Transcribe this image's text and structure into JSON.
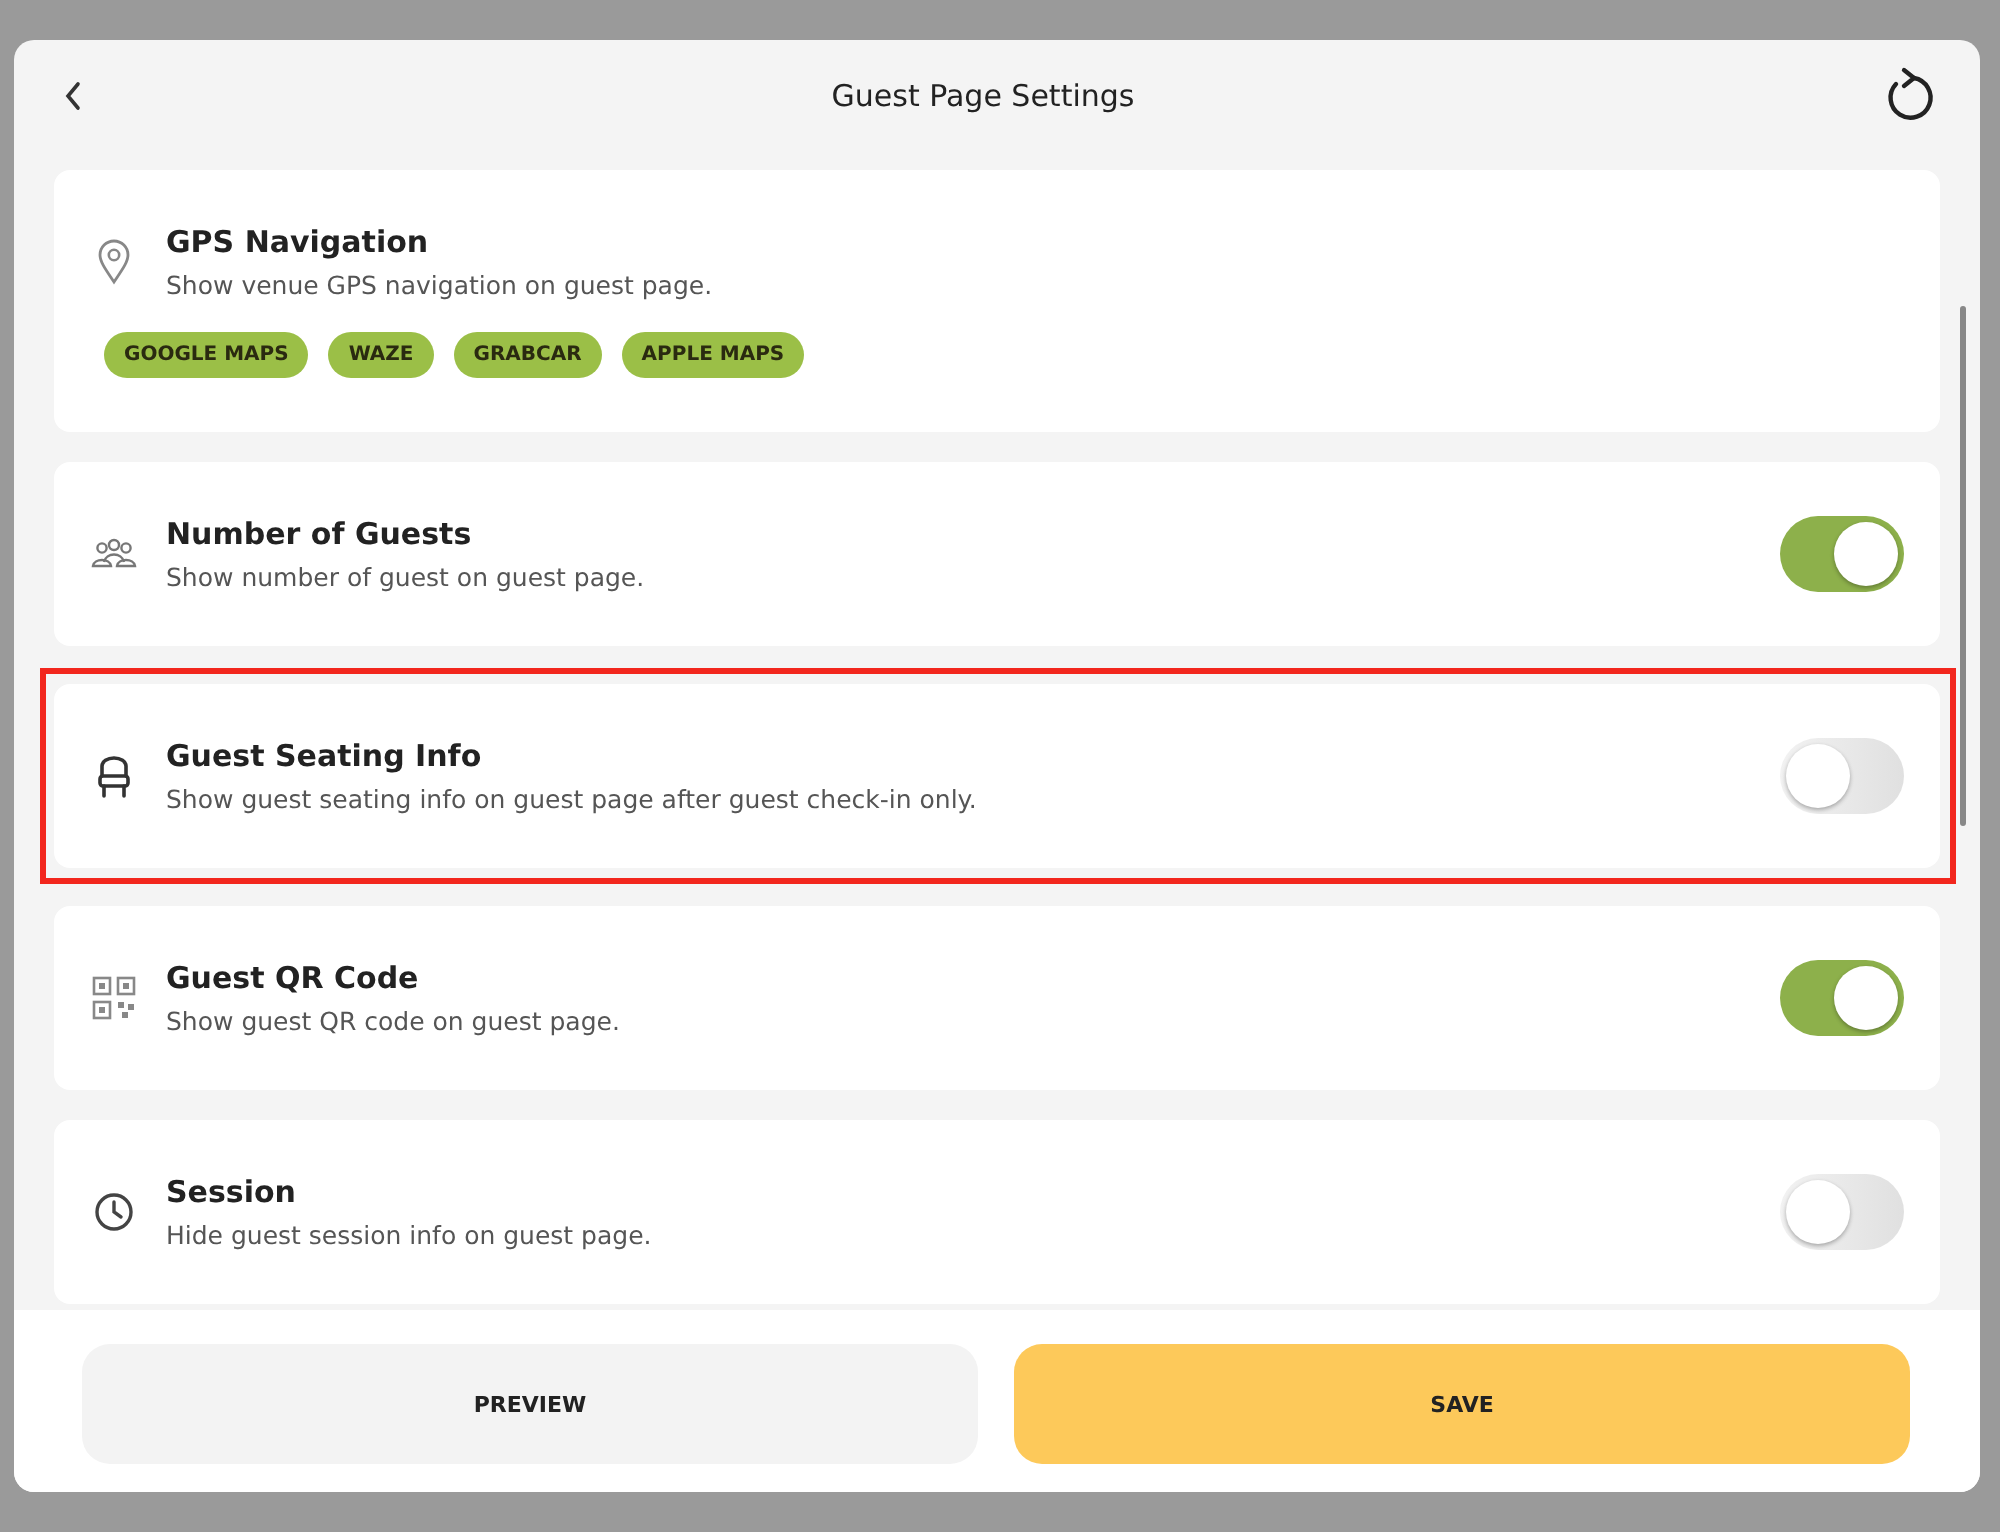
{
  "dialog": {
    "title": "Guest Page Settings"
  },
  "settings": [
    {
      "kind": "links",
      "title": "GPS Navigation",
      "description": "Show venue GPS navigation on guest page.",
      "links": [
        "GOOGLE MAPS",
        "WAZE",
        "GRABCAR",
        "APPLE MAPS"
      ],
      "highlighted": false
    },
    {
      "kind": "toggle",
      "title": "Number of Guests",
      "description": "Show number of guest on guest page.",
      "on": true,
      "highlighted": false
    },
    {
      "kind": "toggle",
      "title": "Guest Seating Info",
      "description": "Show guest seating info on guest page after guest check-in only.",
      "on": false,
      "highlighted": true
    },
    {
      "kind": "toggle",
      "title": "Guest QR Code",
      "description": "Show guest QR code on guest page.",
      "on": true,
      "highlighted": false
    },
    {
      "kind": "toggle",
      "title": "Session",
      "description": "Hide guest session info on guest page.",
      "on": false,
      "highlighted": false
    }
  ],
  "buttons": [
    {
      "label": "PREVIEW",
      "kind": "secondary"
    },
    {
      "label": "SAVE",
      "kind": "primary"
    }
  ]
}
